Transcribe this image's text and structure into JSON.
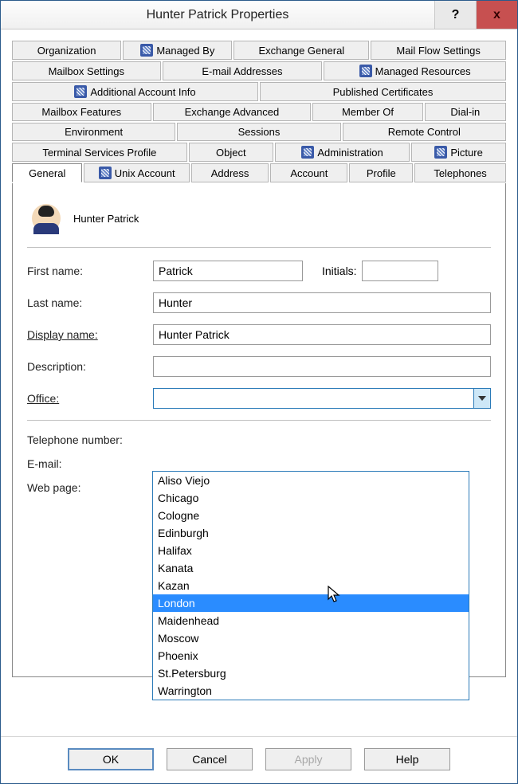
{
  "window": {
    "title": "Hunter Patrick Properties"
  },
  "tabs": {
    "row1": [
      "Organization",
      "Managed By",
      "Exchange General",
      "Mail Flow Settings"
    ],
    "row2": [
      "Mailbox Settings",
      "E-mail Addresses",
      "Managed Resources"
    ],
    "row3": [
      "Additional Account Info",
      "Published Certificates"
    ],
    "row4": [
      "Mailbox Features",
      "Exchange Advanced",
      "Member Of",
      "Dial-in"
    ],
    "row5": [
      "Environment",
      "Sessions",
      "Remote Control"
    ],
    "row6": [
      "Terminal Services Profile",
      "Object",
      "Administration",
      "Picture"
    ],
    "row7": [
      "General",
      "Unix Account",
      "Address",
      "Account",
      "Profile",
      "Telephones"
    ]
  },
  "general": {
    "display_header": "Hunter Patrick",
    "labels": {
      "first_name": "First name:",
      "initials": "Initials:",
      "last_name": "Last name:",
      "display_name": "Display name:",
      "description": "Description:",
      "office": "Office:",
      "telephone": "Telephone number:",
      "email": "E-mail:",
      "webpage": "Web page:"
    },
    "values": {
      "first_name": "Patrick",
      "initials": "",
      "last_name": "Hunter",
      "display_name": "Hunter Patrick",
      "description": "",
      "office": ""
    },
    "office_options": [
      "Aliso Viejo",
      "Chicago",
      "Cologne",
      "Edinburgh",
      "Halifax",
      "Kanata",
      "Kazan",
      "London",
      "Maidenhead",
      "Moscow",
      "Phoenix",
      "St.Petersburg",
      "Warrington"
    ],
    "office_highlight": "London"
  },
  "buttons": {
    "ok": "OK",
    "cancel": "Cancel",
    "apply": "Apply",
    "help": "Help"
  }
}
